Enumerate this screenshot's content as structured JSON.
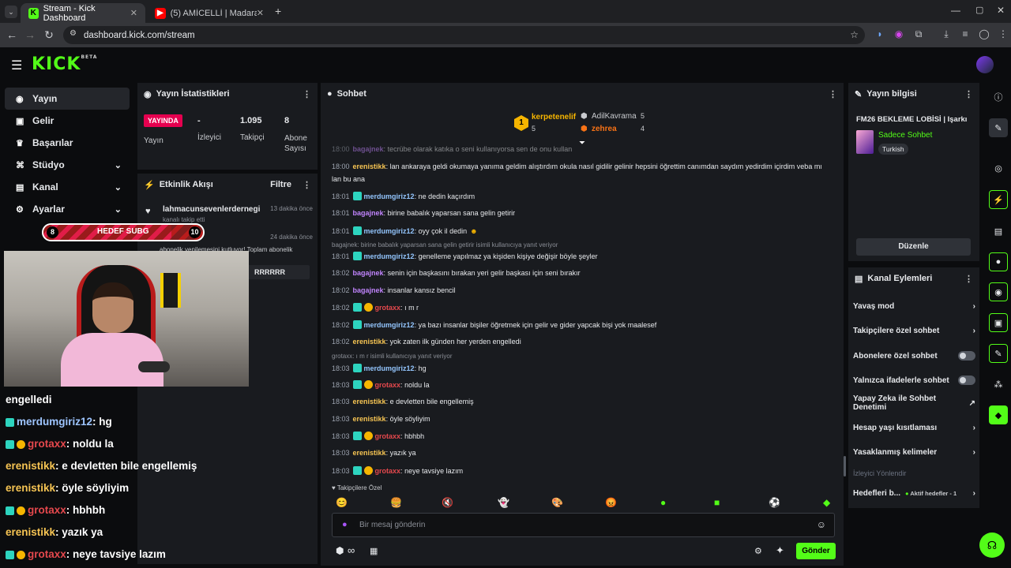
{
  "browser": {
    "tabs": [
      {
        "title": "Stream - Kick Dashboard"
      },
      {
        "title": "(5) AMİCELLİ | Madara Olduk #"
      }
    ],
    "url": "dashboard.kick.com/stream"
  },
  "nav": {
    "items": [
      {
        "label": "Yayın"
      },
      {
        "label": "Gelir"
      },
      {
        "label": "Başarılar"
      },
      {
        "label": "Stüdyo"
      },
      {
        "label": "Kanal"
      },
      {
        "label": "Ayarlar"
      }
    ]
  },
  "goal": {
    "left": "8",
    "label": "HEDEF SUBG",
    "right": "10"
  },
  "stats": {
    "title": "Yayın İstatistikleri",
    "live_badge": "YAYINDA",
    "status_label": "Yayın",
    "viewers_value": "-",
    "viewers_label": "İzleyici",
    "followers_value": "1.095",
    "followers_label": "Takipçi",
    "subs_value": "8",
    "subs_label": "Abone Sayısı"
  },
  "activity": {
    "title": "Etkinlik Akışı",
    "filter": "Filtre",
    "items": [
      {
        "name": "lahmacunsevenlerdernegi",
        "sub": "kanalı takip etti",
        "time": "13 dakika önce"
      },
      {
        "name": "irem",
        "sub": "abonelik yenilemesini kutluyor! Toplam abonelik",
        "time": "24 dakika önce"
      }
    ],
    "msg": "RRRRRR"
  },
  "chat": {
    "title": "Sohbet",
    "top": [
      {
        "name": "kerpetenelif",
        "count": "5"
      },
      {
        "name": "AdilKavrama",
        "count": "5"
      },
      {
        "name": "zehrea",
        "count": "4"
      }
    ],
    "messages": [
      {
        "time": "18:00",
        "user": "bagajnek",
        "text": "tecrübe olarak katıka o seni kullanıyorsa sen de onu kullan"
      },
      {
        "time": "18:00",
        "user": "erenistikk",
        "text": "lan ankaraya geldi okumaya yanıma geldim alıştırdım okula nasıl gidilir gelinir hepsini öğrettim canımdan saydım yedirdim içirdim veba mı"
      },
      {
        "time": "",
        "user": "",
        "text": "lan bu ana"
      },
      {
        "time": "18:01",
        "user": "merdumgiriz12",
        "text": "ne dedin kaçırdım"
      },
      {
        "time": "18:01",
        "user": "bagajnek",
        "text": "birine babalık yaparsan sana gelin getirir"
      },
      {
        "time": "18:01",
        "user": "merdumgiriz12",
        "text": "oyy çok il dedin"
      },
      {
        "time": "18:01",
        "user": "merdumgiriz12",
        "text": "genelleme yapılmaz ya kişiden kişiye değişir böyle şeyler"
      },
      {
        "time": "18:02",
        "user": "bagajnek",
        "text": "senin için başkasını bırakan yeri gelir başkası için seni bırakır"
      },
      {
        "time": "18:02",
        "user": "bagajnek",
        "text": "insanlar kansız bencil"
      },
      {
        "time": "18:02",
        "user": "grotaxx",
        "text": "ı m r"
      },
      {
        "time": "18:02",
        "user": "merdumgiriz12",
        "text": "ya bazı insanlar bişiler öğretmek için gelir ve gider yapcak bişi yok maalesef"
      },
      {
        "time": "18:02",
        "user": "erenistikk",
        "text": "yok zaten ilk günden her yerden engelledi"
      },
      {
        "time": "18:03",
        "user": "merdumgiriz12",
        "text": "hg"
      },
      {
        "time": "18:03",
        "user": "grotaxx",
        "text": "noldu la"
      },
      {
        "time": "18:03",
        "user": "erenistikk",
        "text": "e devletten bile engellemiş"
      },
      {
        "time": "18:03",
        "user": "erenistikk",
        "text": "öyle söyliyim"
      },
      {
        "time": "18:03",
        "user": "grotaxx",
        "text": "hbhbh"
      },
      {
        "time": "18:03",
        "user": "erenistikk",
        "text": "yazık ya"
      },
      {
        "time": "18:03",
        "user": "grotaxx",
        "text": "neye tavsiye lazım"
      }
    ],
    "replies": [
      "bagajnek: birine babalık yaparsan sana gelin getirir isimli kullanıcıya yanıt veriyor",
      "grotaxx: ı m r isimli kullanıcıya yanıt veriyor"
    ],
    "followers_only": "Takipçilere Özel",
    "input_placeholder": "Bir mesaj gönderin",
    "send": "Gönder",
    "infinity": "∞"
  },
  "overlay": {
    "lines": [
      {
        "user": "",
        "text": "engelledi"
      },
      {
        "user": "merdumgiriz12",
        "text": "hg"
      },
      {
        "user": "grotaxx",
        "text": "noldu la"
      },
      {
        "user": "erenistikk",
        "text": "e devletten bile engellemiş"
      },
      {
        "user": "erenistikk",
        "text": "öyle söyliyim"
      },
      {
        "user": "grotaxx",
        "text": "hbhbh"
      },
      {
        "user": "erenistikk",
        "text": "yazık ya"
      },
      {
        "user": "grotaxx",
        "text": "neye tavsiye lazım"
      }
    ]
  },
  "info": {
    "title": "Yayın bilgisi",
    "stream_title": "FM26 BEKLEME LOBİSİ | Işarkı",
    "category": "Sadece Sohbet",
    "language": "Turkish",
    "edit": "Düzenle"
  },
  "actions": {
    "title": "Kanal Eylemleri",
    "items": [
      {
        "label": "Yavaş mod"
      },
      {
        "label": "Takipçilere özel sohbet"
      },
      {
        "label": "Abonelere özel sohbet"
      },
      {
        "label": "Yalnızca ifadelerle sohbet"
      },
      {
        "label": "Yapay Zeka ile Sohbet Denetimi"
      },
      {
        "label": "Hesap yaşı kısıtlaması"
      },
      {
        "label": "Yasaklanmış kelimeler"
      }
    ],
    "section": "İzleyici Yönlendir",
    "goals_label": "Hedefleri b...",
    "goals_status": "Aktif hedefler - 1"
  },
  "colors": {
    "accent": "#53fc18",
    "live": "#e5004f"
  }
}
